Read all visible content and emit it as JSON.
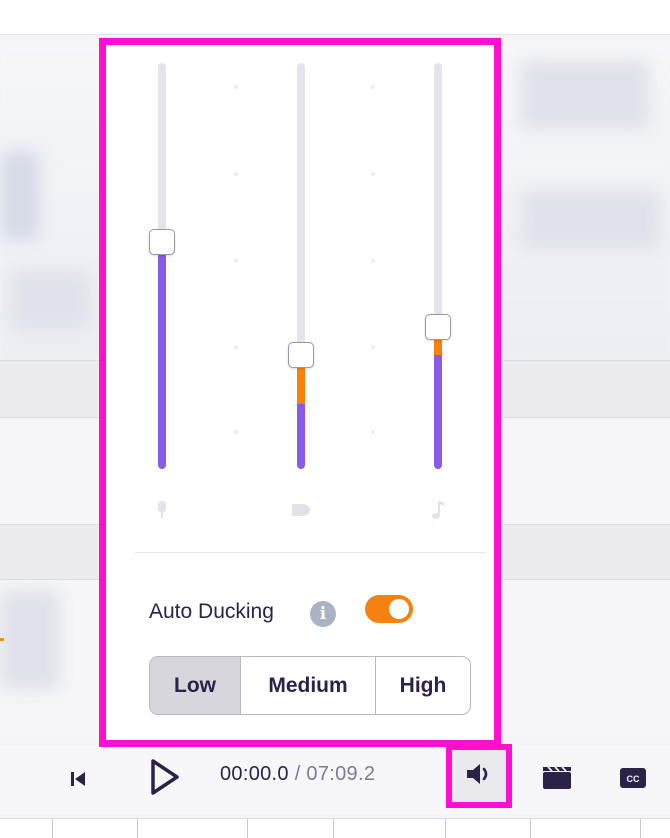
{
  "mixer": {
    "channels": [
      {
        "name": "voice-channel",
        "icon": "microphone-icon",
        "level": 0.56,
        "orange_level": 0.56
      },
      {
        "name": "sfx-channel",
        "icon": "sound-effect-icon",
        "level": 0.16,
        "orange_level": 0.28
      },
      {
        "name": "music-channel",
        "icon": "music-note-icon",
        "level": 0.28,
        "orange_level": 0.35
      }
    ],
    "colors": {
      "primary": "#8a5ce6",
      "ducked": "#f5820f",
      "track": "#e4e4ea"
    }
  },
  "auto_ducking": {
    "label": "Auto Ducking",
    "info_glyph": "i",
    "enabled": true,
    "options": [
      "Low",
      "Medium",
      "High"
    ],
    "selected": "Low"
  },
  "player": {
    "current_time": "00:00.0",
    "separator": " / ",
    "total_time": "07:09.2",
    "controls": [
      "skip-back-icon",
      "play-icon",
      "volume-icon",
      "video-icon",
      "captions-icon"
    ],
    "cc_text": "CC"
  },
  "colors": {
    "highlight": "#ff10cf",
    "text": "#2b2347",
    "muted_text": "#7f7a92"
  }
}
